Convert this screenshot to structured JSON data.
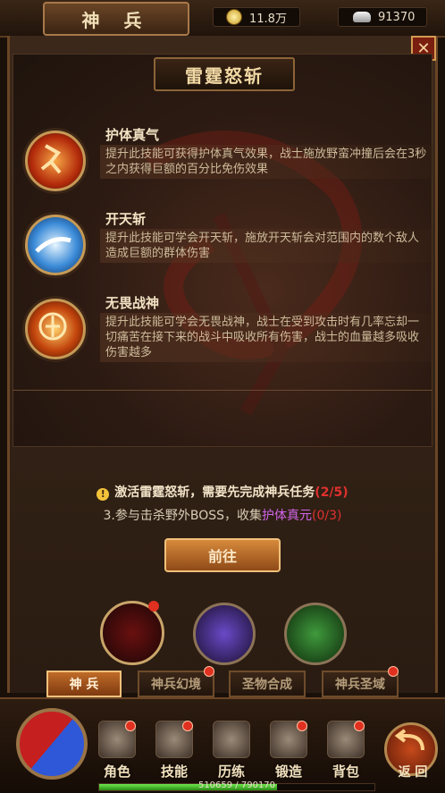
{
  "header": {
    "title": "神 兵",
    "gold": "11.8万",
    "ingots": "91370"
  },
  "skill_panel": {
    "title": "雷霆怒斩",
    "skills": [
      {
        "name": "护体真气",
        "desc": "提升此技能可获得护体真气效果，战士施放野蛮冲撞后会在3秒之内获得巨额的百分比免伤效果",
        "icon": "running-figure-icon"
      },
      {
        "name": "开天斩",
        "desc": "提升此技能可学会开天斩，施放开天斩会对范围内的数个敌人造成巨额的群体伤害",
        "icon": "blade-slash-icon"
      },
      {
        "name": "无畏战神",
        "desc": "提升此技能可学会无畏战神，战士在受到攻击时有几率忘却一切痛苦在接下来的战斗中吸收所有伤害，战士的血量越多吸收伤害越多",
        "icon": "warrior-aura-icon"
      }
    ]
  },
  "requirement": {
    "prefix": "激活雷霆怒斩，需要先完成神兵任务",
    "progress": "(2/5)",
    "task_prefix": "3.参与击杀野外BOSS，收集",
    "task_item": "护体真元",
    "task_progress": "(0/3)"
  },
  "goto_label": "前往",
  "weapons": [
    "warrior-portrait-icon",
    "dark-staff-icon",
    "green-fan-icon"
  ],
  "tabs": [
    {
      "label": "神 兵",
      "active": true,
      "badge": false
    },
    {
      "label": "神兵幻境",
      "active": false,
      "badge": true
    },
    {
      "label": "圣物合成",
      "active": false,
      "badge": false
    },
    {
      "label": "神兵圣域",
      "active": false,
      "badge": true
    }
  ],
  "nav": [
    {
      "label": "角色",
      "icon": "helmet-icon"
    },
    {
      "label": "技能",
      "icon": "skill-book-icon"
    },
    {
      "label": "历练",
      "icon": "armor-icon"
    },
    {
      "label": "锻造",
      "icon": "anvil-icon"
    },
    {
      "label": "背包",
      "icon": "bag-icon"
    }
  ],
  "back_label": "返 回",
  "exp": {
    "text": "510659 / 790170",
    "fraction": 0.646
  },
  "colors": {
    "accent": "#c06b28",
    "warning": "#e0312e",
    "item": "#d064e8"
  }
}
